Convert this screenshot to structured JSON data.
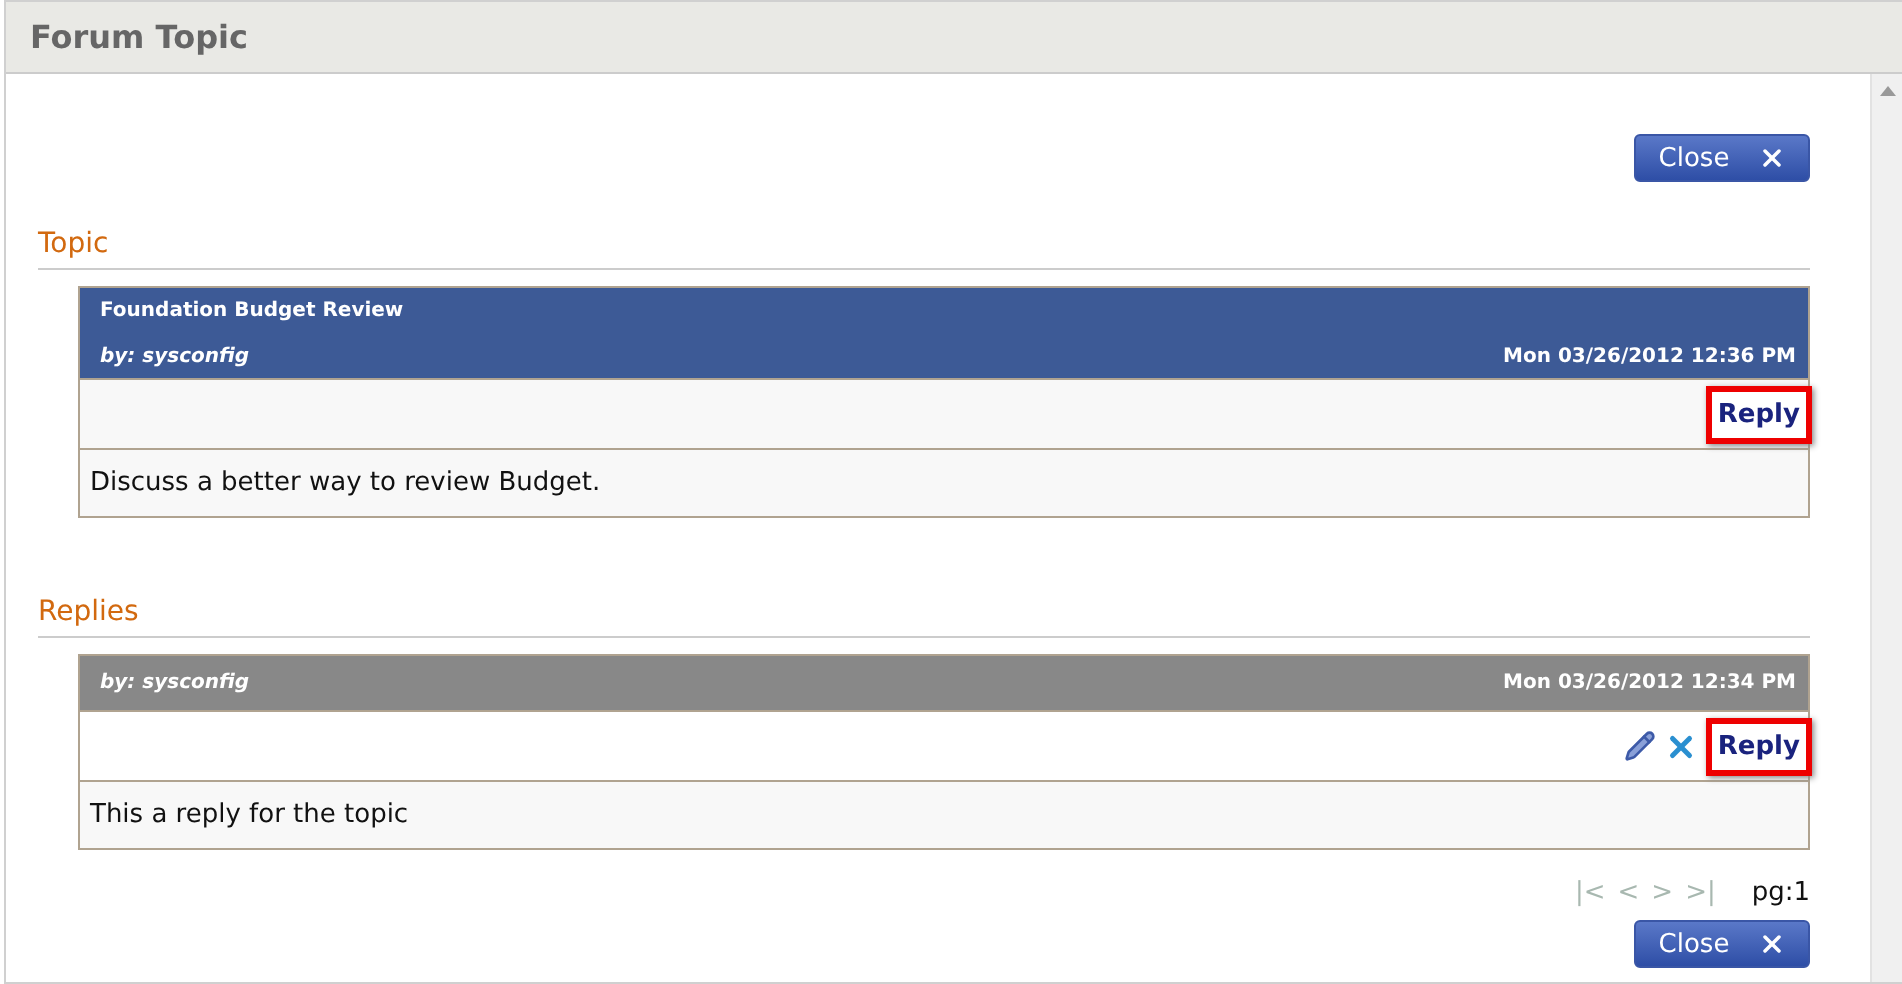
{
  "window": {
    "title": "Forum Topic"
  },
  "close_top": {
    "label": "Close"
  },
  "sections": [
    {
      "heading": "Topic",
      "posts": [
        {
          "kind": "topic",
          "title": "Foundation Budget Review",
          "author": "by: sysconfig",
          "date": "Mon 03/26/2012 12:36 PM",
          "can_edit": false,
          "can_delete": false,
          "reply": {
            "label": "Reply",
            "highlighted": true
          },
          "body": "Discuss a better way to review Budget."
        }
      ]
    },
    {
      "heading": "Replies",
      "posts": [
        {
          "kind": "reply",
          "author": "by: sysconfig",
          "date": "Mon 03/26/2012 12:34 PM",
          "can_edit": true,
          "can_delete": true,
          "reply": {
            "label": "Reply",
            "highlighted": true
          },
          "body": "This a reply for the topic"
        }
      ]
    }
  ],
  "pager": {
    "buttons": [
      {
        "label": "|<",
        "disabled": true
      },
      {
        "label": "<",
        "disabled": true
      },
      {
        "label": ">",
        "disabled": true
      },
      {
        "label": ">|",
        "disabled": true
      }
    ],
    "page": "pg:1"
  },
  "close_bottom": {
    "label": "Close"
  }
}
